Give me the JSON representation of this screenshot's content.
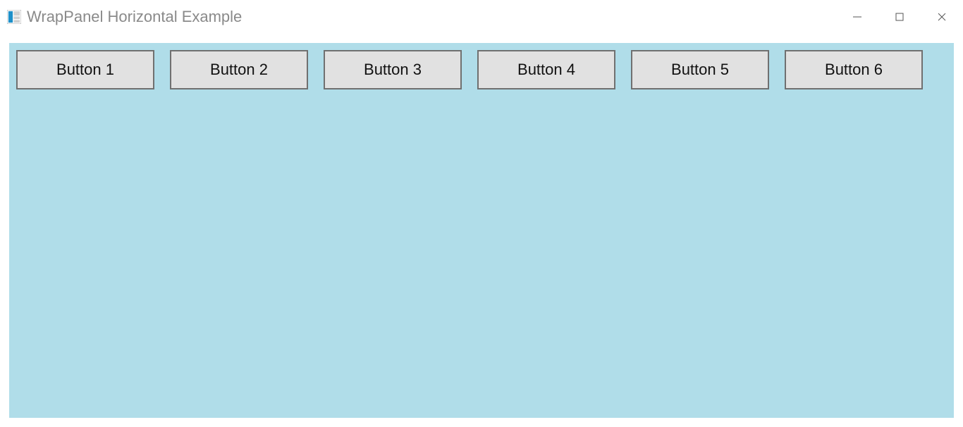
{
  "window": {
    "title": "WrapPanel Horizontal Example"
  },
  "panel": {
    "buttons": [
      {
        "label": "Button 1"
      },
      {
        "label": "Button 2"
      },
      {
        "label": "Button 3"
      },
      {
        "label": "Button 4"
      },
      {
        "label": "Button 5"
      },
      {
        "label": "Button 6"
      }
    ]
  }
}
